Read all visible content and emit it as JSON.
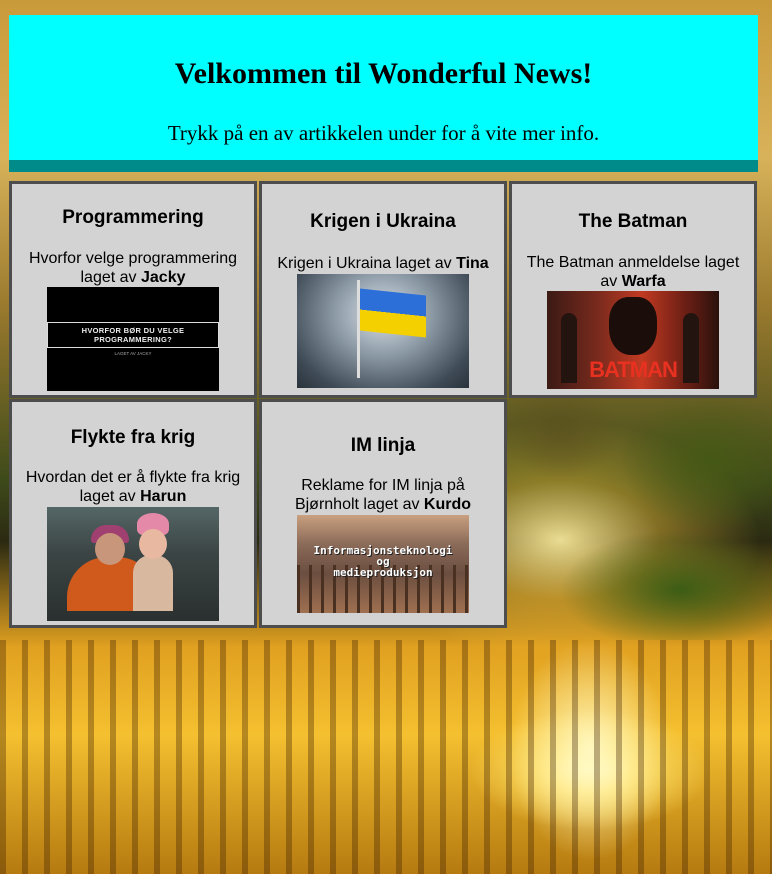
{
  "header": {
    "title": "Velkommen til Wonderful News!",
    "subtitle": "Trykk på en av artikkelen under for å vite mer info."
  },
  "cards": [
    {
      "title": "Programmering",
      "desc_prefix": "Hvorfor velge programmering laget av",
      "author": "Jacky",
      "thumb_text": "HVORFOR BØR DU VELGE PROGRAMMERING?",
      "thumb_sub": "LAGET AV JACKY"
    },
    {
      "title": "Krigen i Ukraina",
      "desc_prefix": "Krigen i Ukraina laget av",
      "author": "Tina"
    },
    {
      "title": "The Batman",
      "desc_prefix": "The Batman anmeldelse laget av",
      "author": "Warfa",
      "thumb_text": "BATMAN"
    },
    {
      "title": "Flykte fra krig",
      "desc_prefix": "Hvordan det er å flykte fra krig laget av",
      "author": "Harun"
    },
    {
      "title": "IM linja",
      "desc_prefix": "Reklame for IM linja på Bjørnholt laget av",
      "author": "Kurdo",
      "thumb_line1": "Informasjonsteknologi",
      "thumb_line2": "og",
      "thumb_line3": "medieproduksjon"
    }
  ],
  "colors": {
    "header_bg": "#00ffff",
    "header_border": "#008b8b",
    "card_bg": "#d3d3d3",
    "card_border": "#4d4d4d"
  }
}
